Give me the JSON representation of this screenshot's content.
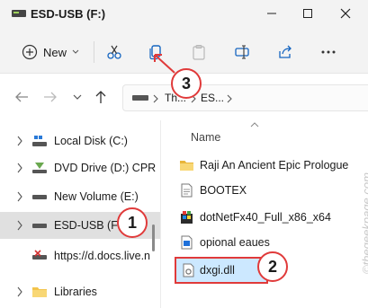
{
  "window": {
    "title": "ESD-USB (F:)"
  },
  "toolbar": {
    "new_label": "New"
  },
  "address": {
    "crumb1": "Th...",
    "crumb2": "ES..."
  },
  "nav": {
    "items": [
      {
        "label": "Local Disk (C:)",
        "icon": "drive-icon"
      },
      {
        "label": "DVD Drive (D:) CPR",
        "icon": "dvd-drive-icon"
      },
      {
        "label": "New Volume (E:)",
        "icon": "drive-icon"
      },
      {
        "label": "ESD-USB (F:)",
        "icon": "usb-drive-icon"
      },
      {
        "label": "https://d.docs.live.n",
        "icon": "network-drive-icon"
      },
      {
        "label": "Libraries",
        "icon": "libraries-icon"
      }
    ]
  },
  "files": {
    "column_header": "Name",
    "items": [
      {
        "label": "Raji An Ancient Epic Prologue",
        "icon": "folder-icon"
      },
      {
        "label": "BOOTEX",
        "icon": "text-file-icon"
      },
      {
        "label": "dotNetFx40_Full_x86_x64",
        "icon": "installer-icon"
      },
      {
        "label": "opional eaues",
        "icon": "image-file-icon"
      },
      {
        "label": "dxgi.dll",
        "icon": "dll-file-icon"
      }
    ]
  },
  "annotations": {
    "badge1": "1",
    "badge2": "2",
    "badge3": "3"
  },
  "watermark": "©thegeekpage.com",
  "colors": {
    "accent": "#e03a3a",
    "selection": "#cce8ff",
    "folder": "#f3c44b"
  }
}
